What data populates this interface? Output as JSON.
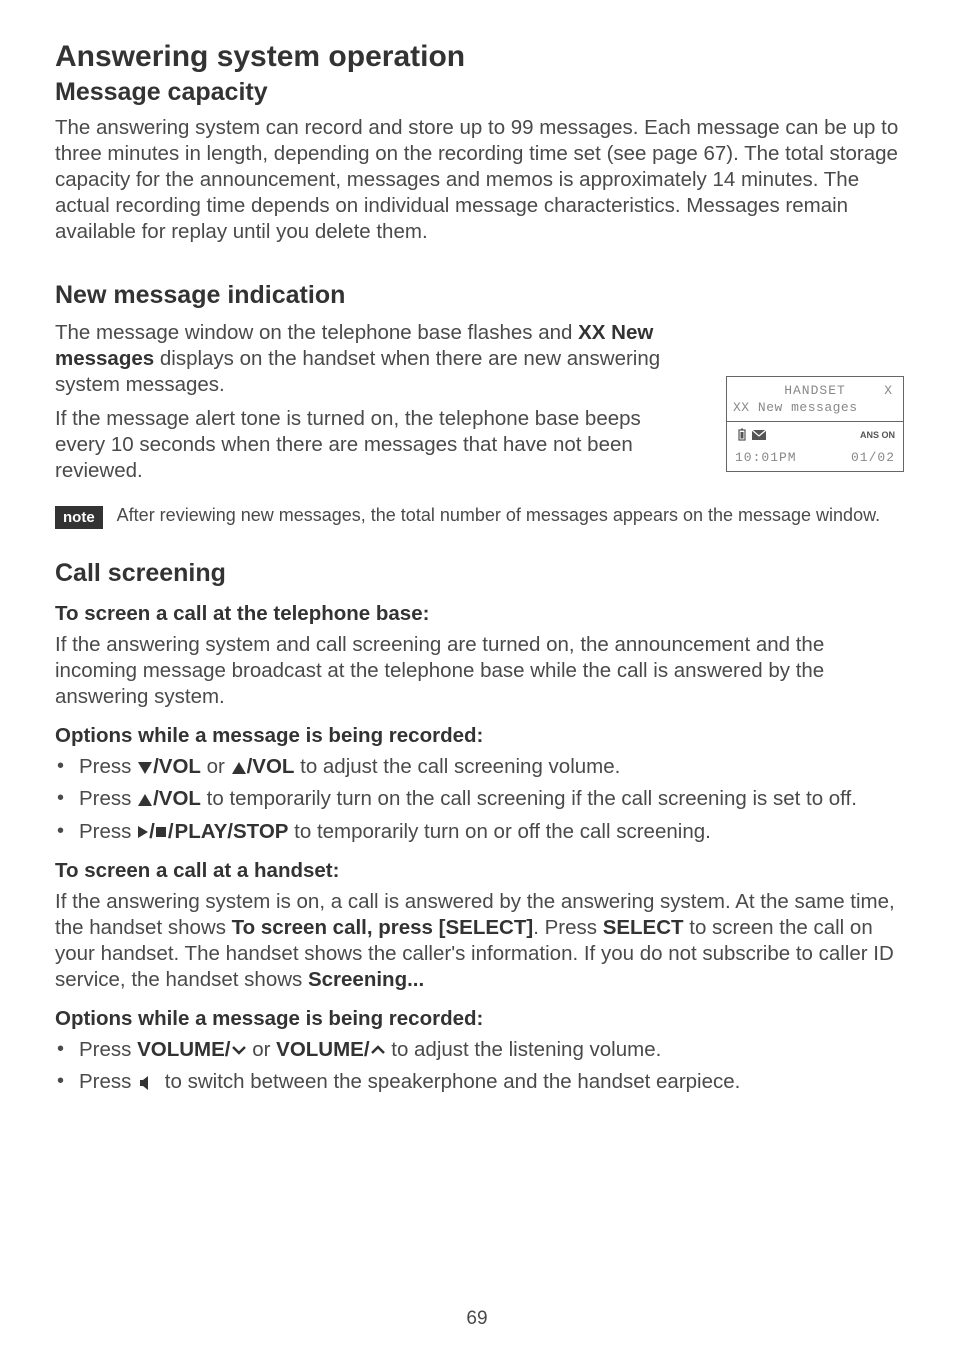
{
  "chapter": "Answering system operation",
  "section1": {
    "title": "Message capacity",
    "body": "The answering system can record and store up to 99 messages. Each message can be up to three minutes in length, depending on the recording time set (see page 67). The total storage capacity for the announcement, messages and memos is approximately 14 minutes. The actual recording time depends on individual message characteristics. Messages remain available for replay until you delete them."
  },
  "section2": {
    "title": "New message indication",
    "body1_pre": "The message window on the telephone base flashes and ",
    "body1_bold": "XX New messages",
    "body1_post": " displays on the handset when there are new answering system messages.",
    "body2": "If the message alert tone is turned on, the telephone base beeps every 10 seconds when there are messages that have not been reviewed."
  },
  "note": {
    "label": "note",
    "text": "After reviewing new messages, the total number of messages appears on the message window."
  },
  "section3": {
    "title": "Call screening",
    "sub1": {
      "title": "To screen a call at the telephone base:",
      "body": "If the answering system and call screening are turned on, the announcement and the incoming message broadcast at the telephone base while the call is answered by the answering system."
    },
    "sub2": {
      "title": "Options while a message is being recorded:",
      "li1_pre": "Press ",
      "li1_b1": "/VOL",
      "li1_mid": " or ",
      "li1_b2": "/VOL",
      "li1_post": " to adjust the call screening volume.",
      "li2_pre": "Press ",
      "li2_b": "/VOL",
      "li2_post": " to temporarily turn on the call screening if the call screening is set to off.",
      "li3_pre": "Press ",
      "li3_b": "PLAY/STOP",
      "li3_post": " to temporarily turn on or off the call screening."
    },
    "sub3": {
      "title": "To screen a call at a handset:",
      "body_pre": "If the answering system is on, a call is answered by the answering system. At the same time, the handset shows ",
      "body_b1": "To screen call, press [SELECT]",
      "body_mid1": ". Press ",
      "body_b2": "SELECT",
      "body_mid2": " to screen the call on your handset. The handset shows the caller's information. If you do not subscribe to caller ID service, the handset shows ",
      "body_b3": "Screening..."
    },
    "sub4": {
      "title": "Options while a message is being recorded:",
      "li1_pre": "Press ",
      "li1_b1": "VOLUME/",
      "li1_mid": " or ",
      "li1_b2": "VOLUME/",
      "li1_post": " to adjust the listening volume.",
      "li2_pre": "Press ",
      "li2_post": " to switch between the speakerphone and the handset earpiece."
    }
  },
  "screen": {
    "handset": "HANDSET",
    "x": "X",
    "newmsg": "XX New messages",
    "ans_on": "ANS ON",
    "time": "10:01PM",
    "date": "01/02"
  },
  "page_number": "69"
}
